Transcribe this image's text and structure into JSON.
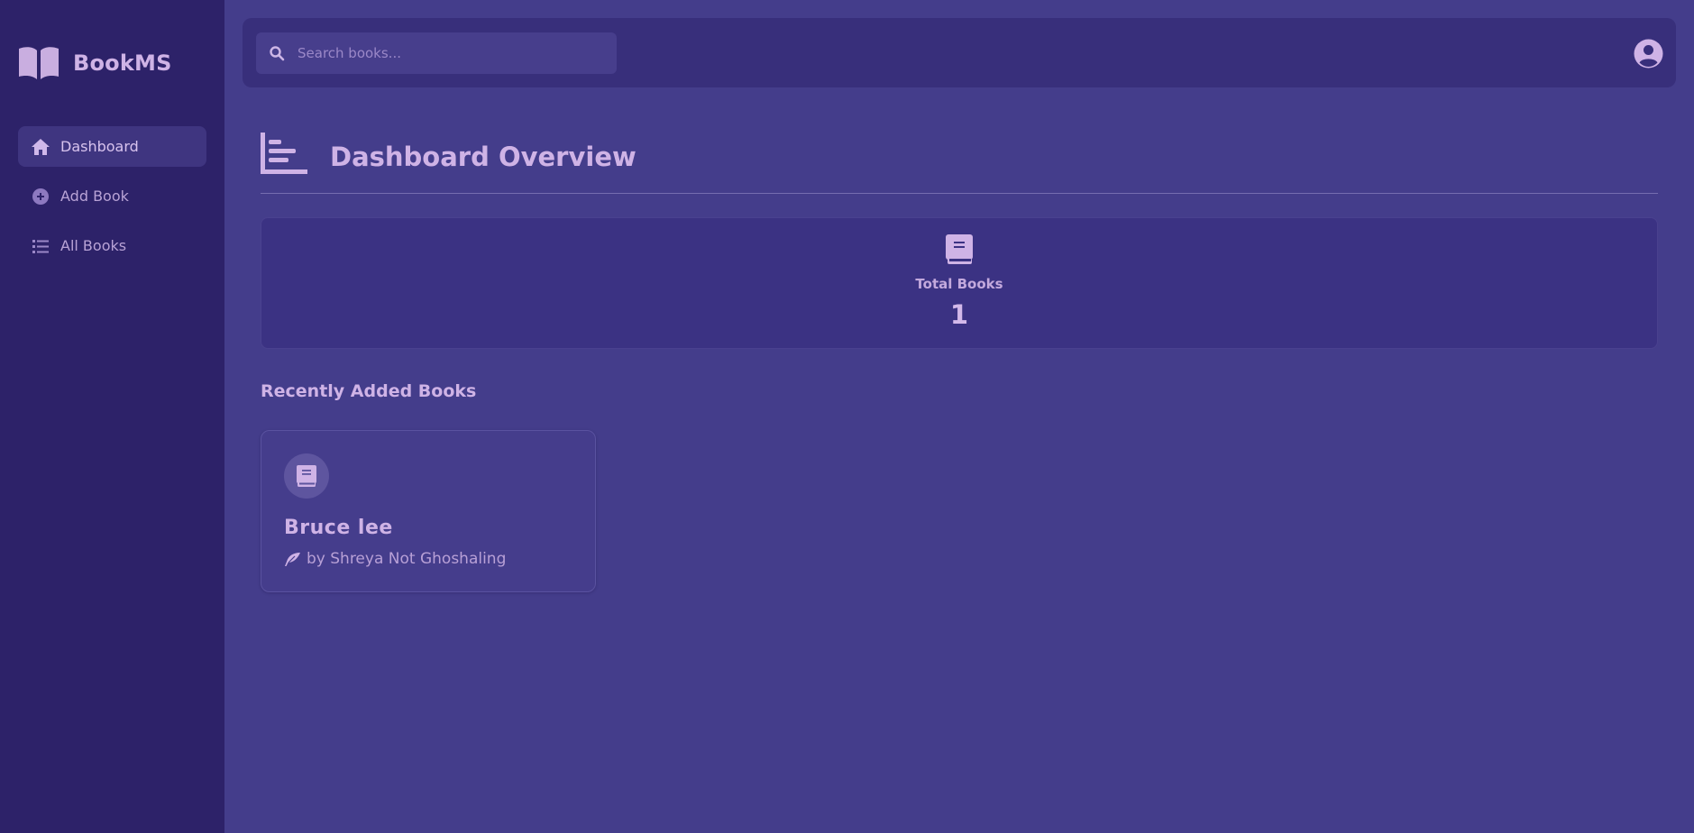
{
  "app": {
    "name": "BookMS",
    "brand_icon": "book-open-icon"
  },
  "sidebar": {
    "items": [
      {
        "label": "Dashboard",
        "icon": "home-icon",
        "active": true
      },
      {
        "label": "Add Book",
        "icon": "plus-circle-icon",
        "active": false
      },
      {
        "label": "All Books",
        "icon": "list-icon",
        "active": false
      }
    ]
  },
  "topbar": {
    "search": {
      "placeholder": "Search books...",
      "value": "",
      "icon": "search-icon"
    },
    "user_icon": "user-circle-icon"
  },
  "page": {
    "title": "Dashboard Overview",
    "title_icon": "bar-chart-icon"
  },
  "stats": {
    "total_books": {
      "label": "Total Books",
      "value": "1",
      "icon": "book-icon"
    }
  },
  "recent": {
    "title": "Recently Added Books",
    "books": [
      {
        "title": "Bruce lee",
        "author": "by Shreya Not Ghoshaling",
        "icon": "book-icon",
        "author_icon": "feather-icon"
      }
    ]
  },
  "colors": {
    "sidebar_bg": "#2d2269",
    "main_bg": "#443d8b",
    "card_bg": "#3b3283",
    "accent_text": "#cfb3e6"
  }
}
